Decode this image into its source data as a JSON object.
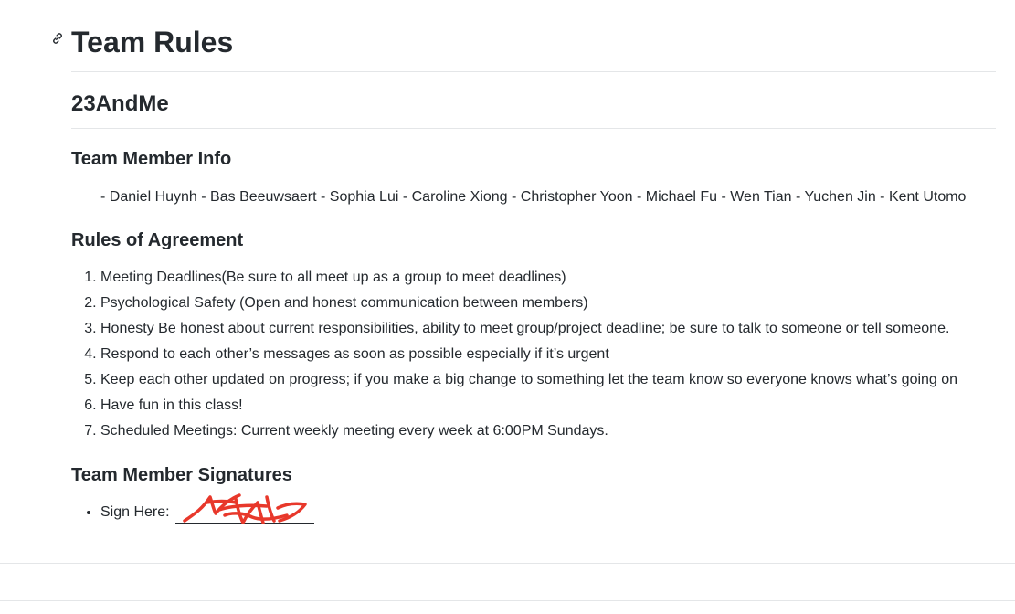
{
  "document": {
    "title": "Team Rules",
    "subtitle": "23AndMe"
  },
  "team_info": {
    "heading": "Team Member Info",
    "members_line": "- Daniel Huynh - Bas Beeuwsaert - Sophia Lui - Caroline Xiong - Christopher Yoon - Michael Fu - Wen Tian - Yuchen Jin - Kent Utomo"
  },
  "rules": {
    "heading": "Rules of Agreement",
    "items": [
      "Meeting Deadlines(Be sure to all meet up as a group to meet deadlines)",
      "Psychological Safety (Open and honest communication between members)",
      "Honesty Be honest about current responsibilities, ability to meet group/project deadline; be sure to talk to someone or tell someone.",
      "Respond to each other’s messages as soon as possible especially if it’s urgent",
      "Keep each other updated on progress; if you make a big change to something let the team know so everyone knows what’s going on",
      "Have fun in this class!",
      "Scheduled Meetings: Current weekly meeting every week at 6:00PM Sundays."
    ]
  },
  "signatures": {
    "heading": "Team Member Signatures",
    "sign_label": "Sign Here:",
    "signature_color": "#e8382b"
  },
  "icons": {
    "heading_anchor": "link-icon"
  },
  "colors": {
    "text": "#24292e",
    "divider": "#e4e6e8"
  }
}
